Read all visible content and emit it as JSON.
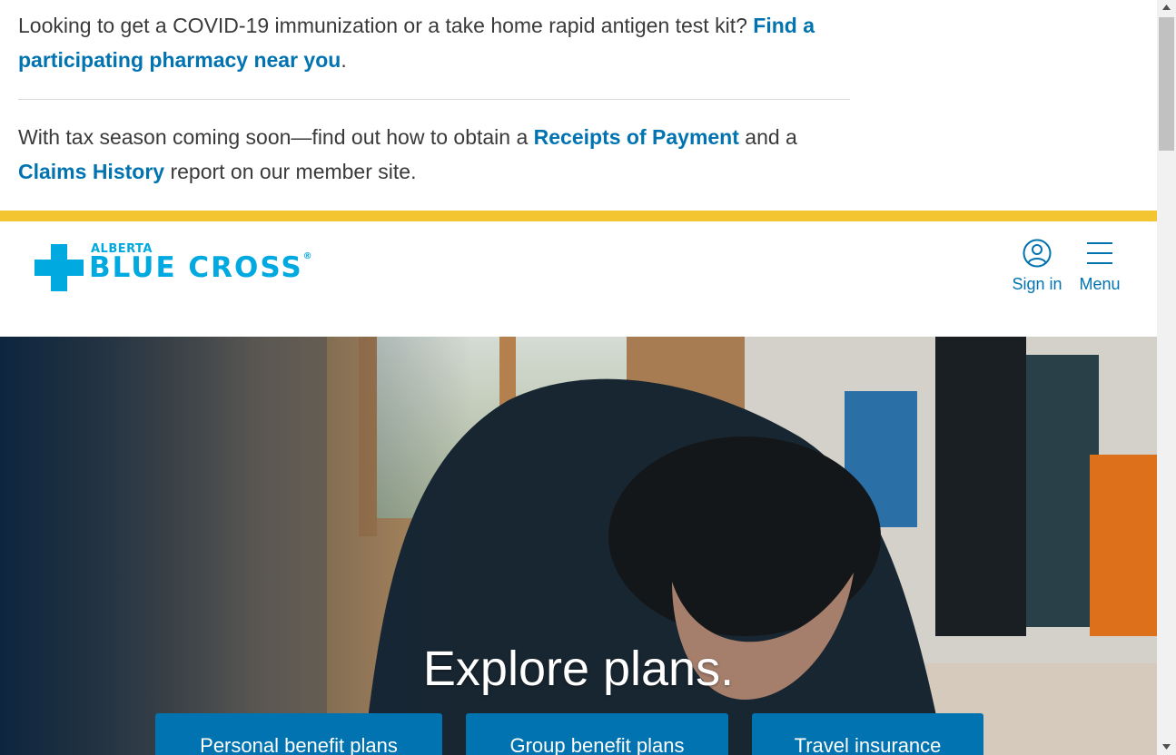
{
  "alerts": {
    "covid": {
      "text": "Looking to get a COVID-19 immunization or a take home rapid antigen test kit? ",
      "link": "Find a participating pharmacy near you",
      "suffix": "."
    },
    "tax": {
      "text1": "With tax season coming soon—find out how to obtain a ",
      "link1": "Receipts of Payment",
      "text2": " and a ",
      "link2": "Claims History",
      "text3": " report on our member site."
    }
  },
  "header": {
    "logo": {
      "small": "ALBERTA",
      "big": "BLUE CROSS",
      "reg": "®"
    },
    "signin_label": "Sign in",
    "menu_label": "Menu"
  },
  "hero": {
    "title": "Explore plans.",
    "buttons": {
      "personal": "Personal benefit plans",
      "group": "Group benefit plans",
      "travel": "Travel insurance"
    }
  },
  "colors": {
    "link": "#0073b0",
    "brand": "#00a9e0",
    "yellow": "#f2c531",
    "button": "#0073b0"
  },
  "icons": {
    "signin": "user-circle-icon",
    "menu": "hamburger-menu-icon",
    "scroll_up": "triangle-up-icon",
    "scroll_down": "triangle-down-icon"
  }
}
